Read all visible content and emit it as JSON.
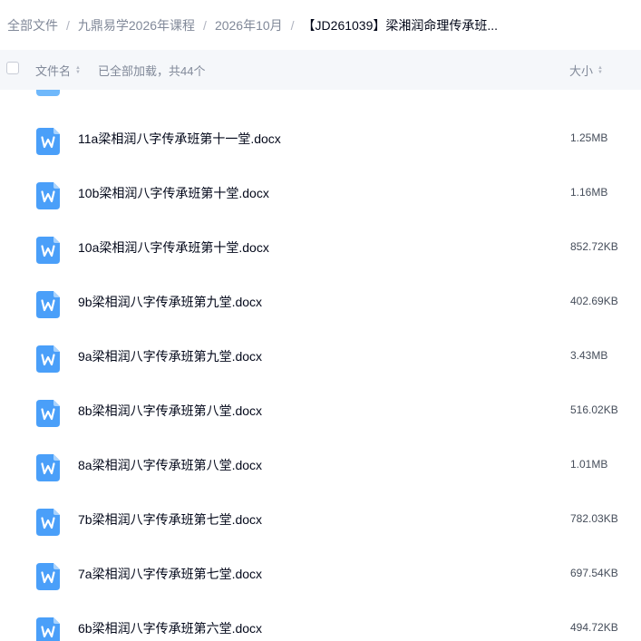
{
  "breadcrumb": {
    "items": [
      "全部文件",
      "九鼎易学2026年课程",
      "2026年10月",
      "【JD261039】梁湘润命理传承班..."
    ],
    "separator": "/"
  },
  "list_header": {
    "name_label": "文件名",
    "loaded_text": "已全部加载，共44个",
    "size_label": "大小"
  },
  "files": [
    {
      "name": "11a梁相润八字传承班第十一堂.docx",
      "size": "1.25MB"
    },
    {
      "name": "10b梁相润八字传承班第十堂.docx",
      "size": "1.16MB"
    },
    {
      "name": "10a梁相润八字传承班第十堂.docx",
      "size": "852.72KB"
    },
    {
      "name": "9b梁相润八字传承班第九堂.docx",
      "size": "402.69KB"
    },
    {
      "name": "9a梁相润八字传承班第九堂.docx",
      "size": "3.43MB"
    },
    {
      "name": "8b梁相润八字传承班第八堂.docx",
      "size": "516.02KB"
    },
    {
      "name": "8a梁相润八字传承班第八堂.docx",
      "size": "1.01MB"
    },
    {
      "name": "7b梁相润八字传承班第七堂.docx",
      "size": "782.03KB"
    },
    {
      "name": "7a梁相润八字传承班第七堂.docx",
      "size": "697.54KB"
    },
    {
      "name": "6b梁相润八字传承班第六堂.docx",
      "size": "494.72KB"
    }
  ],
  "icons": {
    "word_doc": "word-doc-icon",
    "sort": "sort-icon"
  },
  "colors": {
    "icon_blue": "#4a9ff9",
    "icon_fold": "#a9d3fd",
    "header_bg": "#f5f7fa"
  }
}
